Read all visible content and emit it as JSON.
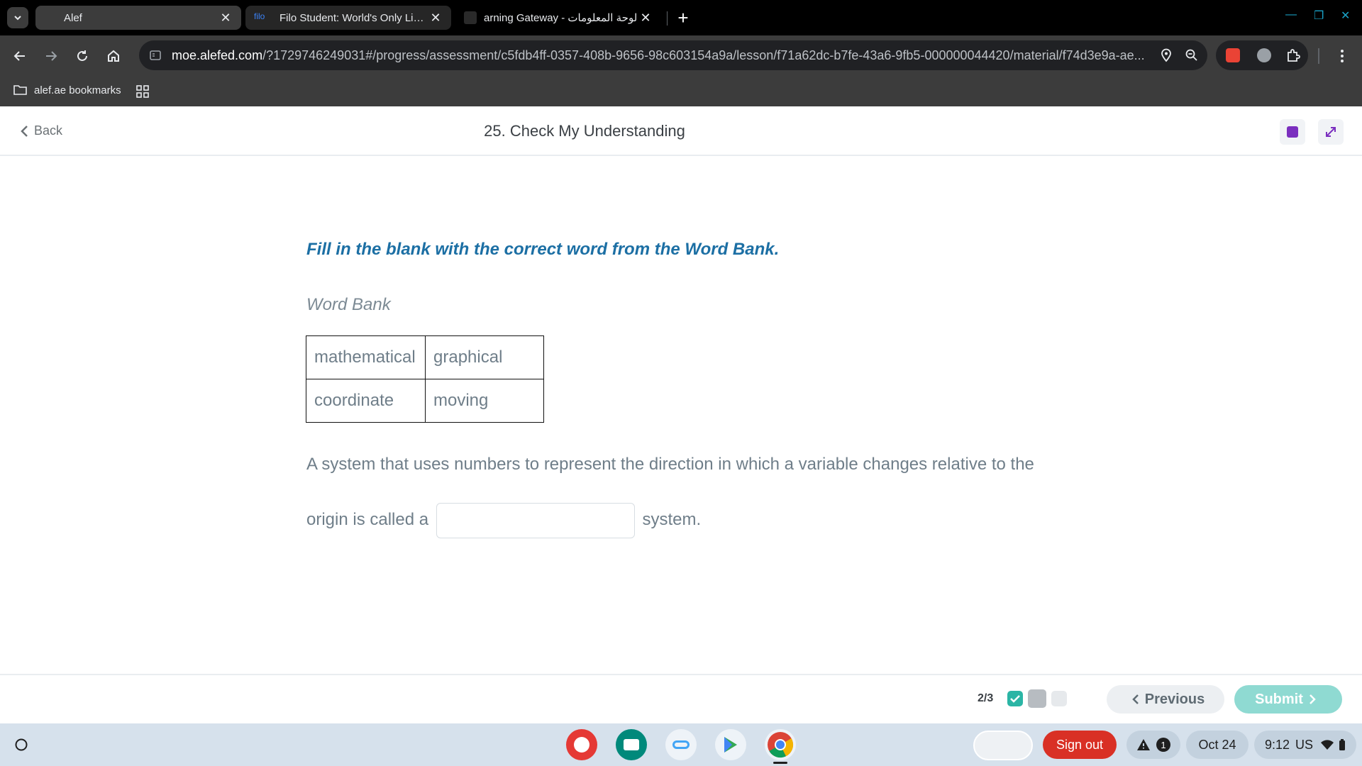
{
  "browser": {
    "tabs": [
      {
        "title": "Alef",
        "active": true
      },
      {
        "title": "Filo Student: World's Only Live I",
        "favicon_text": "filo"
      },
      {
        "title": "arning Gateway - لوحة المعلومات"
      }
    ],
    "url_host": "moe.alefed.com",
    "url_rest": "/?1729746249031#/progress/assessment/c5fdb4ff-0357-408b-9656-98c603154a9a/lesson/f71a62dc-b7fe-43a6-9fb5-000000044420/material/f74d3e9a-ae...",
    "bookmark_folder": "alef.ae bookmarks"
  },
  "header": {
    "back_label": "Back",
    "lesson_title": "25. Check My Understanding"
  },
  "question": {
    "instruction": "Fill in the blank with the correct word from the Word Bank.",
    "word_bank_label": "Word Bank",
    "word_bank": [
      [
        "mathematical",
        "graphical"
      ],
      [
        "coordinate",
        "moving"
      ]
    ],
    "text_before": "A system that uses numbers to represent the direction in which a variable changes relative to the origin is called a",
    "text_after": "system.",
    "answer_value": ""
  },
  "footer": {
    "progress": "2/3",
    "previous_label": "Previous",
    "submit_label": "Submit"
  },
  "shelf": {
    "signout_label": "Sign out",
    "notification_count": "1",
    "date": "Oct 24",
    "time": "9:12",
    "locale": "US"
  },
  "colors": {
    "accent_blue": "#1c6fa4",
    "submit_teal": "#8fdad2",
    "check_teal": "#2bb5a5",
    "signout_red": "#d93025"
  }
}
